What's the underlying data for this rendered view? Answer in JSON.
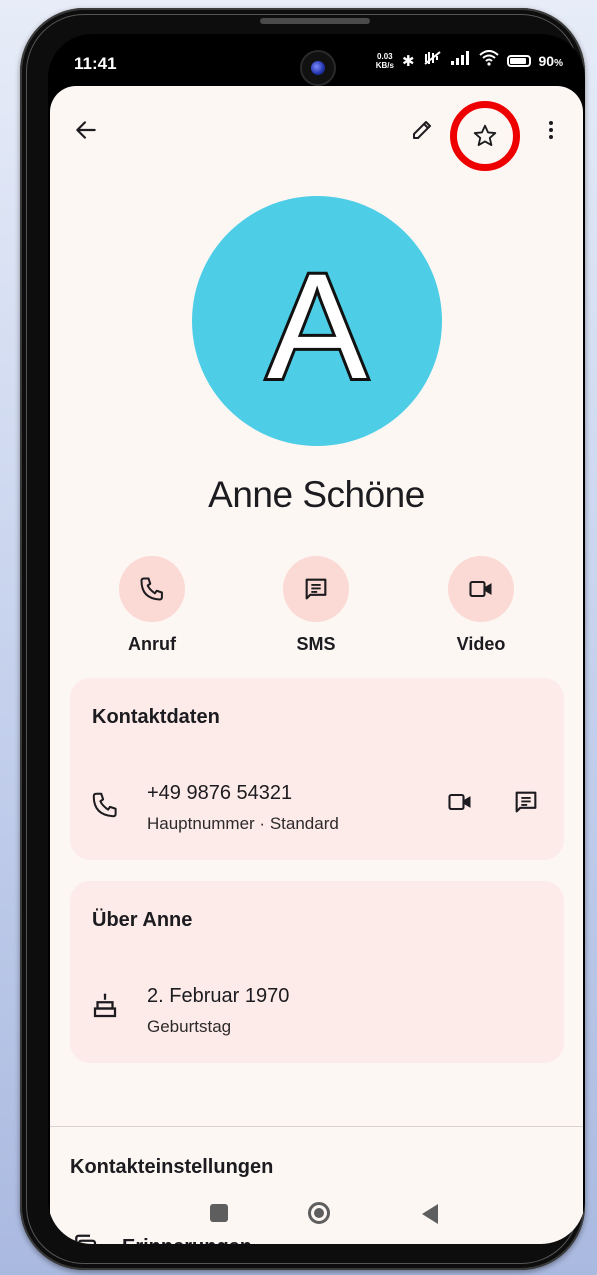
{
  "status_bar": {
    "time": "11:41",
    "net_speed_value": "0.03",
    "net_speed_unit": "KB/s",
    "battery": "90",
    "battery_unit": "%",
    "icons": [
      "bluetooth-icon",
      "mute-vibrate-icon",
      "signal-icon",
      "wifi-icon",
      "battery-icon"
    ]
  },
  "toolbar": {
    "back_icon": "arrow-left-icon",
    "edit_icon": "pencil-icon",
    "favorite_icon": "star-outline-icon",
    "favorite_highlight_color": "#ee0000",
    "more_icon": "more-vert-icon"
  },
  "contact": {
    "initial": "A",
    "avatar_color": "#4ecde6",
    "name": "Anne Schöne"
  },
  "actions": [
    {
      "label": "Anruf",
      "icon": "phone-icon"
    },
    {
      "label": "SMS",
      "icon": "message-icon"
    },
    {
      "label": "Video",
      "icon": "videocam-icon"
    }
  ],
  "contact_card": {
    "title": "Kontaktdaten",
    "phone": "+49 9876 54321",
    "phone_type": "Hauptnummer · Standard"
  },
  "about_card": {
    "title": "Über Anne",
    "birthday": "2. Februar 1970",
    "birthday_label": "Geburtstag"
  },
  "settings": {
    "heading": "Kontakteinstellungen",
    "reminders_label": "Erinnerungen"
  },
  "colors": {
    "background": "#fdf7f4",
    "action_circle": "#fbd9d4",
    "card": "#fdebe9"
  }
}
